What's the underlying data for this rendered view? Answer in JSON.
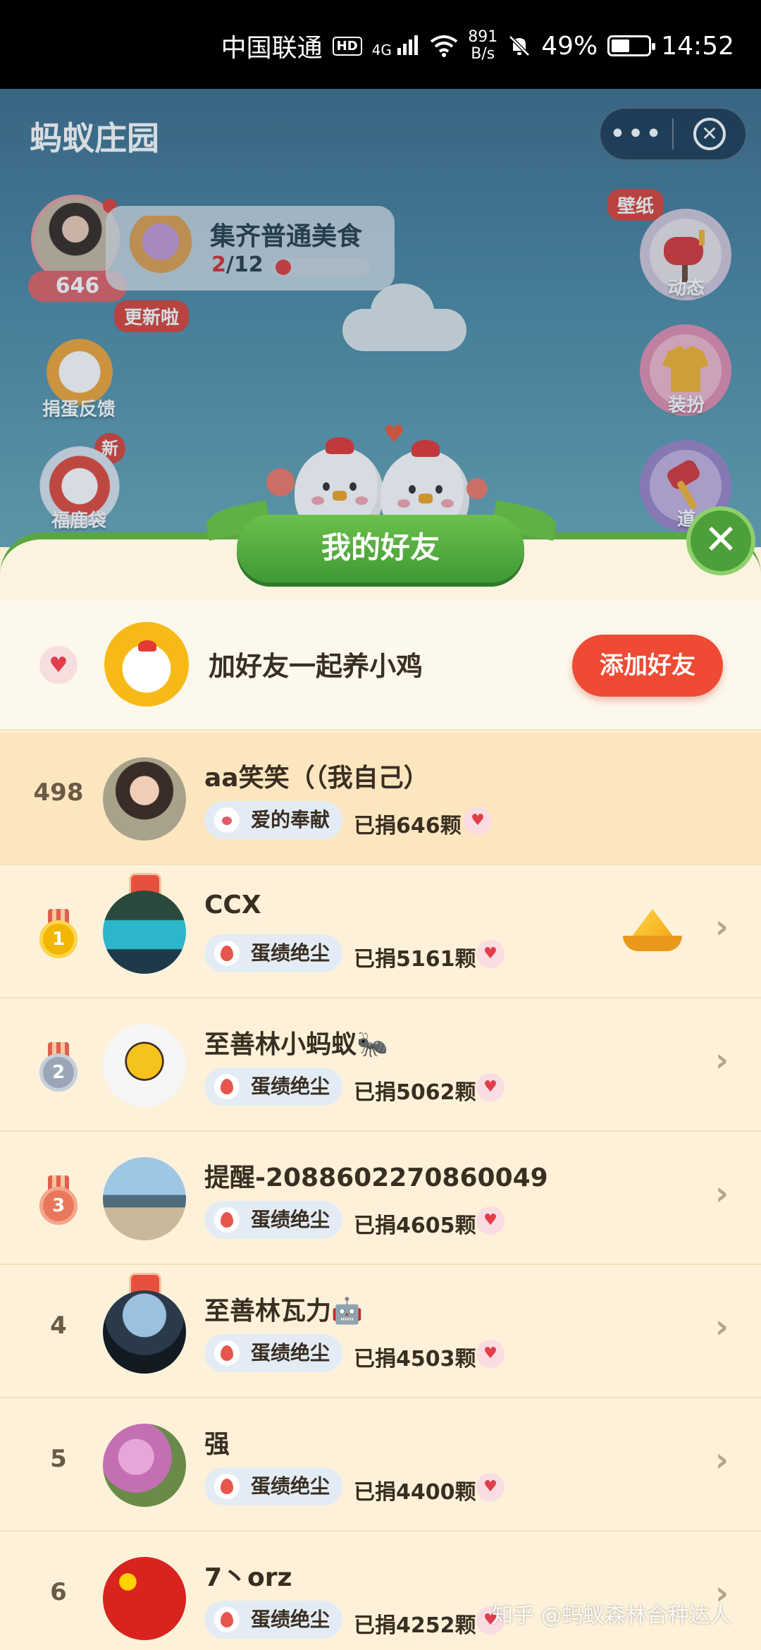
{
  "status_bar": {
    "carrier": "中国联通",
    "hd": "HD",
    "network": "4G",
    "speed_value": "891",
    "speed_unit": "B/s",
    "battery": "49%",
    "battery_level": 0.49,
    "time": "14:52"
  },
  "app": {
    "title": "蚂蚁庄园",
    "more_label": "•••",
    "close_label": "✕"
  },
  "game": {
    "my_score": "646",
    "task_title": "集齐普通美食",
    "task_current": "2",
    "task_total": "/12",
    "task_progress": 0.1667,
    "wallpaper_badge": "壁纸",
    "updated_badge": "更新啦",
    "new_badge": "新",
    "left_buttons": [
      "捐蛋反馈",
      "福鹿袋"
    ],
    "right_buttons": [
      "动态",
      "装扮",
      "道"
    ]
  },
  "friends_panel": {
    "title": "我的好友",
    "add_prompt": "加好友一起养小鸡",
    "add_button": "添加好友"
  },
  "friends": [
    {
      "rank": "498",
      "name": "aa笑笑（（我自己）",
      "tag": "爱的奉献",
      "donated": "已捐646颗",
      "self": true
    },
    {
      "rank": "1",
      "name": "CCX",
      "tag": "蛋绩绝尘",
      "donated": "已捐5161颗"
    },
    {
      "rank": "2",
      "name": "至善林小蚂蚁🐜",
      "tag": "蛋绩绝尘",
      "donated": "已捐5062颗"
    },
    {
      "rank": "3",
      "name": "提醒-2088602270860049",
      "tag": "蛋绩绝尘",
      "donated": "已捐4605颗"
    },
    {
      "rank": "4",
      "name": "至善林瓦力🤖",
      "tag": "蛋绩绝尘",
      "donated": "已捐4503颗"
    },
    {
      "rank": "5",
      "name": "强",
      "tag": "蛋绩绝尘",
      "donated": "已捐4400颗"
    },
    {
      "rank": "6",
      "name": "7丶orz",
      "tag": "蛋绩绝尘",
      "donated": "已捐4252颗"
    }
  ],
  "watermark": "知乎 @蚂蚁森林合种达人",
  "colors": {
    "accent_red": "#ef4a33",
    "panel_green": "#4c9f39",
    "row_bg": "#fdf1d9",
    "self_row_bg": "#fbe6bf"
  }
}
